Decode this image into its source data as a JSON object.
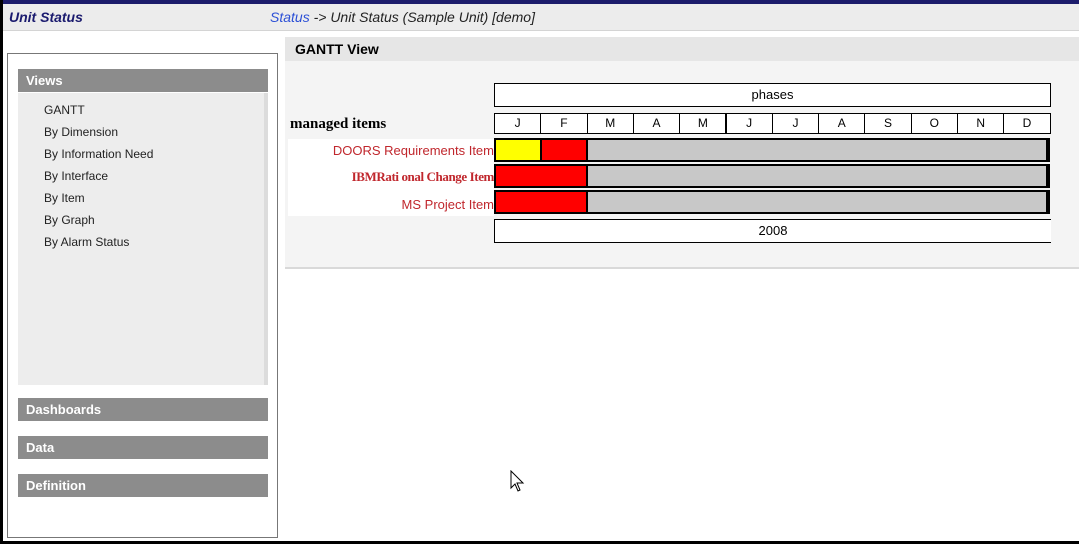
{
  "header": {
    "app_title": "Unit Status",
    "breadcrumb_link": "Status",
    "breadcrumb_rest": " -> Unit Status (Sample Unit) [demo]"
  },
  "sidebar": {
    "views": {
      "title": "Views",
      "items": [
        "GANTT",
        "By Dimension",
        "By Information Need",
        "By Interface",
        "By Item",
        "By Graph",
        "By Alarm Status"
      ]
    },
    "dashboards": "Dashboards",
    "data": "Data",
    "definition": "Definition"
  },
  "gantt": {
    "view_title": "GANTT View",
    "phases_label": "phases",
    "rows_header": "managed items",
    "months": [
      "J",
      "F",
      "M",
      "A",
      "M",
      "J",
      "J",
      "A",
      "S",
      "O",
      "N",
      "D"
    ],
    "year": "2008",
    "colors": {
      "yellow": "#ffff00",
      "red": "#ff0000",
      "gray": "#c8c8c8"
    },
    "items": [
      {
        "label": "DOORS Requirements Item",
        "segments": [
          {
            "months": 1,
            "color": "yellow"
          },
          {
            "months": 1,
            "color": "red"
          },
          {
            "months": 10,
            "color": "gray"
          }
        ]
      },
      {
        "label": "IBMRati onal Change Item",
        "segments": [
          {
            "months": 2,
            "color": "red"
          },
          {
            "months": 10,
            "color": "gray"
          }
        ]
      },
      {
        "label": "MS Project Item",
        "segments": [
          {
            "months": 2,
            "color": "red"
          },
          {
            "months": 10,
            "color": "gray"
          }
        ]
      }
    ]
  }
}
